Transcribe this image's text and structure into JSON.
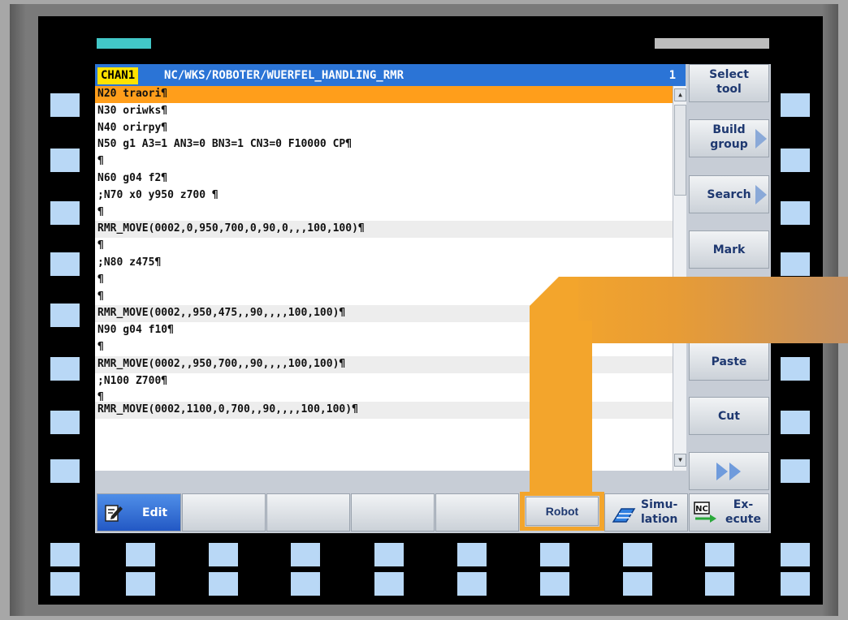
{
  "header": {
    "channel": "CHAN1",
    "path": "NC/WKS/ROBOTER/WUERFEL_HANDLING_RMR",
    "number": "1"
  },
  "editor": {
    "lines": [
      "N20 traori¶",
      "N30 oriwks¶",
      "N40 orirpy¶",
      "N50 g1 A3=1 AN3=0 BN3=1 CN3=0 F10000 CP¶",
      "¶",
      "N60 g04 f2¶",
      ";N70 x0 y950 z700 ¶",
      "¶",
      "RMR_MOVE(0002,0,950,700,0,90,0,,,100,100)¶",
      "¶",
      ";N80 z475¶",
      "¶",
      "¶",
      "RMR_MOVE(0002,,950,475,,90,,,,100,100)¶",
      "N90 g04 f10¶",
      "¶",
      "RMR_MOVE(0002,,950,700,,90,,,,100,100)¶",
      ";N100 Z700¶",
      "¶",
      "RMR_MOVE(0002,1100,0,700,,90,,,,100,100)¶"
    ]
  },
  "right_softkeys": {
    "select_tool": "Select\ntool",
    "build_group": "Build\ngroup",
    "search": "Search",
    "mark": "Mark",
    "paste": "Paste",
    "cut": "Cut"
  },
  "bottom_softkeys": {
    "edit": "Edit",
    "robot": "Robot",
    "simulation": "Simu-\nlation",
    "execute": "Ex-\necute",
    "nc_badge": "NC"
  },
  "icons": {
    "edit": "pencil-paper-icon",
    "simulation": "simulation-icon",
    "execute": "nc-execute-icon",
    "more": "double-chevron-right-icon"
  },
  "colors": {
    "accent_orange": "#f3a52c",
    "header_blue": "#2b74d6",
    "channel_yellow": "#ffe300",
    "hardkey_blue": "#b9d8f6",
    "teal_led": "#42c7c7"
  }
}
